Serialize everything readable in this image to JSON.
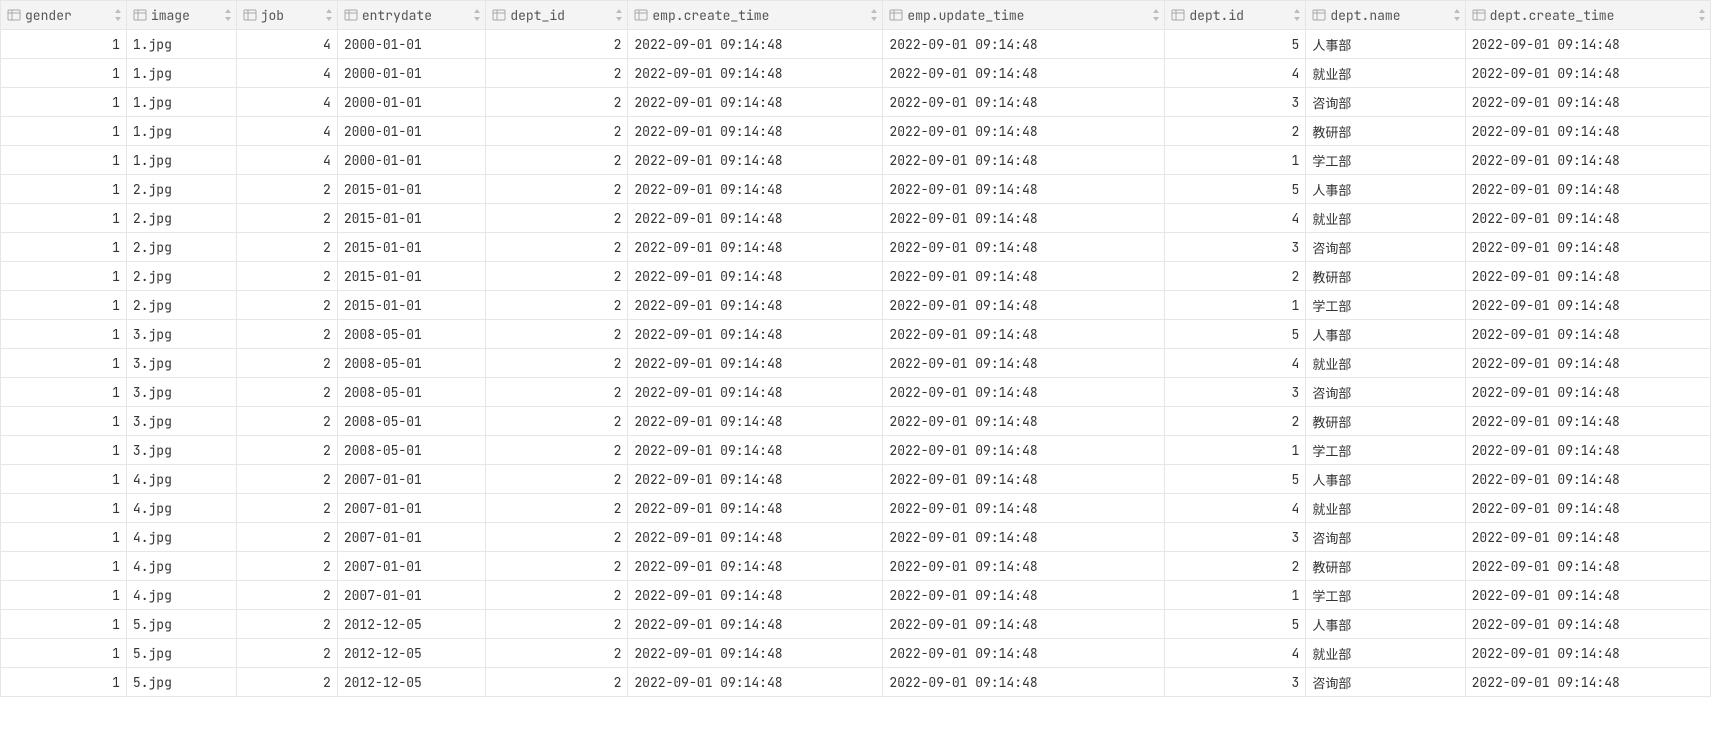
{
  "columns": [
    {
      "key": "gender",
      "label": "gender",
      "type": "num",
      "cls": "c-gender"
    },
    {
      "key": "image",
      "label": "image",
      "type": "txt",
      "cls": "c-image"
    },
    {
      "key": "job",
      "label": "job",
      "type": "num",
      "cls": "c-job"
    },
    {
      "key": "entrydate",
      "label": "entrydate",
      "type": "txt",
      "cls": "c-entrydate"
    },
    {
      "key": "dept_id",
      "label": "dept_id",
      "type": "num",
      "cls": "c-deptid"
    },
    {
      "key": "emp_create_time",
      "label": "emp.create_time",
      "type": "txt",
      "cls": "c-create"
    },
    {
      "key": "emp_update_time",
      "label": "emp.update_time",
      "type": "txt",
      "cls": "c-update"
    },
    {
      "key": "dept_pk",
      "label": "dept.id",
      "type": "num",
      "cls": "c-did"
    },
    {
      "key": "dept_name",
      "label": "dept.name",
      "type": "txt",
      "cls": "c-dname"
    },
    {
      "key": "dept_create_time",
      "label": "dept.create_time",
      "type": "txt",
      "cls": "c-dcreate"
    }
  ],
  "rows": [
    {
      "gender": "1",
      "image": "1.jpg",
      "job": "4",
      "entrydate": "2000-01-01",
      "dept_id": "2",
      "emp_create_time": "2022-09-01 09:14:48",
      "emp_update_time": "2022-09-01 09:14:48",
      "dept_pk": "5",
      "dept_name": "人事部",
      "dept_create_time": "2022-09-01 09:14:48"
    },
    {
      "gender": "1",
      "image": "1.jpg",
      "job": "4",
      "entrydate": "2000-01-01",
      "dept_id": "2",
      "emp_create_time": "2022-09-01 09:14:48",
      "emp_update_time": "2022-09-01 09:14:48",
      "dept_pk": "4",
      "dept_name": "就业部",
      "dept_create_time": "2022-09-01 09:14:48"
    },
    {
      "gender": "1",
      "image": "1.jpg",
      "job": "4",
      "entrydate": "2000-01-01",
      "dept_id": "2",
      "emp_create_time": "2022-09-01 09:14:48",
      "emp_update_time": "2022-09-01 09:14:48",
      "dept_pk": "3",
      "dept_name": "咨询部",
      "dept_create_time": "2022-09-01 09:14:48"
    },
    {
      "gender": "1",
      "image": "1.jpg",
      "job": "4",
      "entrydate": "2000-01-01",
      "dept_id": "2",
      "emp_create_time": "2022-09-01 09:14:48",
      "emp_update_time": "2022-09-01 09:14:48",
      "dept_pk": "2",
      "dept_name": "教研部",
      "dept_create_time": "2022-09-01 09:14:48"
    },
    {
      "gender": "1",
      "image": "1.jpg",
      "job": "4",
      "entrydate": "2000-01-01",
      "dept_id": "2",
      "emp_create_time": "2022-09-01 09:14:48",
      "emp_update_time": "2022-09-01 09:14:48",
      "dept_pk": "1",
      "dept_name": "学工部",
      "dept_create_time": "2022-09-01 09:14:48"
    },
    {
      "gender": "1",
      "image": "2.jpg",
      "job": "2",
      "entrydate": "2015-01-01",
      "dept_id": "2",
      "emp_create_time": "2022-09-01 09:14:48",
      "emp_update_time": "2022-09-01 09:14:48",
      "dept_pk": "5",
      "dept_name": "人事部",
      "dept_create_time": "2022-09-01 09:14:48"
    },
    {
      "gender": "1",
      "image": "2.jpg",
      "job": "2",
      "entrydate": "2015-01-01",
      "dept_id": "2",
      "emp_create_time": "2022-09-01 09:14:48",
      "emp_update_time": "2022-09-01 09:14:48",
      "dept_pk": "4",
      "dept_name": "就业部",
      "dept_create_time": "2022-09-01 09:14:48"
    },
    {
      "gender": "1",
      "image": "2.jpg",
      "job": "2",
      "entrydate": "2015-01-01",
      "dept_id": "2",
      "emp_create_time": "2022-09-01 09:14:48",
      "emp_update_time": "2022-09-01 09:14:48",
      "dept_pk": "3",
      "dept_name": "咨询部",
      "dept_create_time": "2022-09-01 09:14:48"
    },
    {
      "gender": "1",
      "image": "2.jpg",
      "job": "2",
      "entrydate": "2015-01-01",
      "dept_id": "2",
      "emp_create_time": "2022-09-01 09:14:48",
      "emp_update_time": "2022-09-01 09:14:48",
      "dept_pk": "2",
      "dept_name": "教研部",
      "dept_create_time": "2022-09-01 09:14:48"
    },
    {
      "gender": "1",
      "image": "2.jpg",
      "job": "2",
      "entrydate": "2015-01-01",
      "dept_id": "2",
      "emp_create_time": "2022-09-01 09:14:48",
      "emp_update_time": "2022-09-01 09:14:48",
      "dept_pk": "1",
      "dept_name": "学工部",
      "dept_create_time": "2022-09-01 09:14:48"
    },
    {
      "gender": "1",
      "image": "3.jpg",
      "job": "2",
      "entrydate": "2008-05-01",
      "dept_id": "2",
      "emp_create_time": "2022-09-01 09:14:48",
      "emp_update_time": "2022-09-01 09:14:48",
      "dept_pk": "5",
      "dept_name": "人事部",
      "dept_create_time": "2022-09-01 09:14:48"
    },
    {
      "gender": "1",
      "image": "3.jpg",
      "job": "2",
      "entrydate": "2008-05-01",
      "dept_id": "2",
      "emp_create_time": "2022-09-01 09:14:48",
      "emp_update_time": "2022-09-01 09:14:48",
      "dept_pk": "4",
      "dept_name": "就业部",
      "dept_create_time": "2022-09-01 09:14:48"
    },
    {
      "gender": "1",
      "image": "3.jpg",
      "job": "2",
      "entrydate": "2008-05-01",
      "dept_id": "2",
      "emp_create_time": "2022-09-01 09:14:48",
      "emp_update_time": "2022-09-01 09:14:48",
      "dept_pk": "3",
      "dept_name": "咨询部",
      "dept_create_time": "2022-09-01 09:14:48"
    },
    {
      "gender": "1",
      "image": "3.jpg",
      "job": "2",
      "entrydate": "2008-05-01",
      "dept_id": "2",
      "emp_create_time": "2022-09-01 09:14:48",
      "emp_update_time": "2022-09-01 09:14:48",
      "dept_pk": "2",
      "dept_name": "教研部",
      "dept_create_time": "2022-09-01 09:14:48"
    },
    {
      "gender": "1",
      "image": "3.jpg",
      "job": "2",
      "entrydate": "2008-05-01",
      "dept_id": "2",
      "emp_create_time": "2022-09-01 09:14:48",
      "emp_update_time": "2022-09-01 09:14:48",
      "dept_pk": "1",
      "dept_name": "学工部",
      "dept_create_time": "2022-09-01 09:14:48"
    },
    {
      "gender": "1",
      "image": "4.jpg",
      "job": "2",
      "entrydate": "2007-01-01",
      "dept_id": "2",
      "emp_create_time": "2022-09-01 09:14:48",
      "emp_update_time": "2022-09-01 09:14:48",
      "dept_pk": "5",
      "dept_name": "人事部",
      "dept_create_time": "2022-09-01 09:14:48"
    },
    {
      "gender": "1",
      "image": "4.jpg",
      "job": "2",
      "entrydate": "2007-01-01",
      "dept_id": "2",
      "emp_create_time": "2022-09-01 09:14:48",
      "emp_update_time": "2022-09-01 09:14:48",
      "dept_pk": "4",
      "dept_name": "就业部",
      "dept_create_time": "2022-09-01 09:14:48"
    },
    {
      "gender": "1",
      "image": "4.jpg",
      "job": "2",
      "entrydate": "2007-01-01",
      "dept_id": "2",
      "emp_create_time": "2022-09-01 09:14:48",
      "emp_update_time": "2022-09-01 09:14:48",
      "dept_pk": "3",
      "dept_name": "咨询部",
      "dept_create_time": "2022-09-01 09:14:48"
    },
    {
      "gender": "1",
      "image": "4.jpg",
      "job": "2",
      "entrydate": "2007-01-01",
      "dept_id": "2",
      "emp_create_time": "2022-09-01 09:14:48",
      "emp_update_time": "2022-09-01 09:14:48",
      "dept_pk": "2",
      "dept_name": "教研部",
      "dept_create_time": "2022-09-01 09:14:48"
    },
    {
      "gender": "1",
      "image": "4.jpg",
      "job": "2",
      "entrydate": "2007-01-01",
      "dept_id": "2",
      "emp_create_time": "2022-09-01 09:14:48",
      "emp_update_time": "2022-09-01 09:14:48",
      "dept_pk": "1",
      "dept_name": "学工部",
      "dept_create_time": "2022-09-01 09:14:48"
    },
    {
      "gender": "1",
      "image": "5.jpg",
      "job": "2",
      "entrydate": "2012-12-05",
      "dept_id": "2",
      "emp_create_time": "2022-09-01 09:14:48",
      "emp_update_time": "2022-09-01 09:14:48",
      "dept_pk": "5",
      "dept_name": "人事部",
      "dept_create_time": "2022-09-01 09:14:48"
    },
    {
      "gender": "1",
      "image": "5.jpg",
      "job": "2",
      "entrydate": "2012-12-05",
      "dept_id": "2",
      "emp_create_time": "2022-09-01 09:14:48",
      "emp_update_time": "2022-09-01 09:14:48",
      "dept_pk": "4",
      "dept_name": "就业部",
      "dept_create_time": "2022-09-01 09:14:48"
    },
    {
      "gender": "1",
      "image": "5.jpg",
      "job": "2",
      "entrydate": "2012-12-05",
      "dept_id": "2",
      "emp_create_time": "2022-09-01 09:14:48",
      "emp_update_time": "2022-09-01 09:14:48",
      "dept_pk": "3",
      "dept_name": "咨询部",
      "dept_create_time": "2022-09-01 09:14:48"
    }
  ]
}
